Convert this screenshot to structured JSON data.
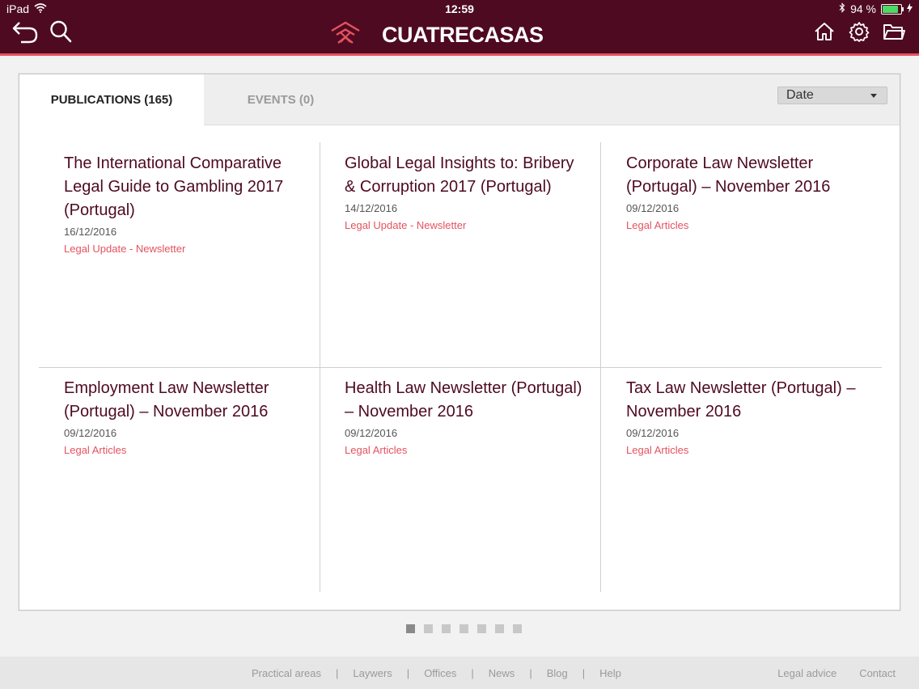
{
  "status_bar": {
    "device": "iPad",
    "time": "12:59",
    "battery_percent_label": "94 %",
    "battery_level": 0.94
  },
  "header": {
    "brand": "CUATRECASAS",
    "accent_color": "#e5525e",
    "background_color": "#4e0a21",
    "icons": [
      "back-arrow-icon",
      "search-icon",
      "home-icon",
      "gear-icon",
      "folder-icon"
    ]
  },
  "tabs": [
    {
      "label": "PUBLICATIONS (165)",
      "active": true
    },
    {
      "label": "EVENTS (0)",
      "active": false
    }
  ],
  "sort": {
    "selected": "Date"
  },
  "publications": [
    {
      "title": "The International Comparative Legal Guide to Gambling 2017 (Portugal)",
      "date": "16/12/2016",
      "category": "Legal Update - Newsletter"
    },
    {
      "title": "Global Legal Insights to: Bribery & Corruption 2017 (Portugal)",
      "date": "14/12/2016",
      "category": "Legal Update - Newsletter"
    },
    {
      "title": "Corporate Law Newsletter (Portugal) – November 2016",
      "date": "09/12/2016",
      "category": "Legal Articles"
    },
    {
      "title": "Employment Law Newsletter (Portugal) – November 2016",
      "date": "09/12/2016",
      "category": "Legal Articles"
    },
    {
      "title": "Health Law Newsletter (Portugal) – November 2016",
      "date": "09/12/2016",
      "category": "Legal Articles"
    },
    {
      "title": "Tax Law Newsletter (Portugal) – November 2016",
      "date": "09/12/2016",
      "category": "Legal Articles"
    }
  ],
  "pagination": {
    "pages": 7,
    "current": 1
  },
  "footer": {
    "links": [
      "Practical areas",
      "Laywers",
      "Offices",
      "News",
      "Blog",
      "Help"
    ],
    "separator": "|",
    "right_links": [
      "Legal advice",
      "Contact"
    ]
  }
}
